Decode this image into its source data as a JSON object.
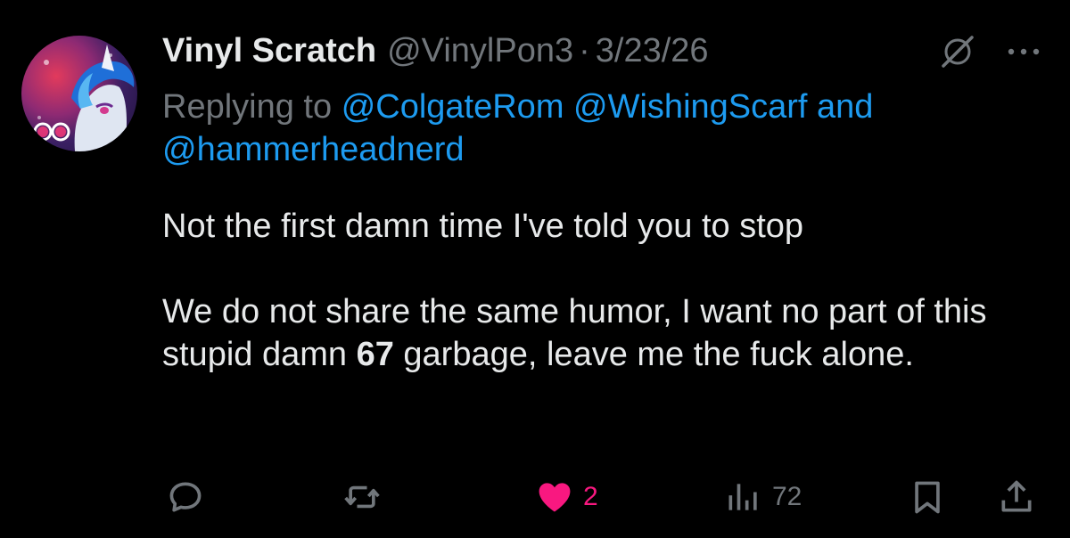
{
  "tweet": {
    "display_name": "Vinyl Scratch",
    "handle": "@VinylPon3",
    "separator": "·",
    "date": "3/23/26",
    "replying_prefix": "Replying to",
    "mentions": [
      "@ColgateRom",
      "@WishingScarf"
    ],
    "mentions_joiner": "and",
    "mention_last": "@hammerheadnerd",
    "body_line1": "Not the first damn time I've told you to stop",
    "body_line2_before": "We do not share the same humor, I want no part of this stupid damn ",
    "body_line2_bold": "67",
    "body_line2_after": " garbage, leave me the fuck alone."
  },
  "actions": {
    "reply_icon": "reply-icon",
    "retweet_icon": "retweet-icon",
    "like_icon": "heart-filled-icon",
    "like_count": "2",
    "views_icon": "views-icon",
    "views_count": "72",
    "bookmark_icon": "bookmark-icon",
    "share_icon": "share-icon"
  },
  "colors": {
    "background": "#000000",
    "text": "#e7e9ea",
    "muted": "#71767b",
    "link": "#1d9bf0",
    "like": "#f91880"
  }
}
